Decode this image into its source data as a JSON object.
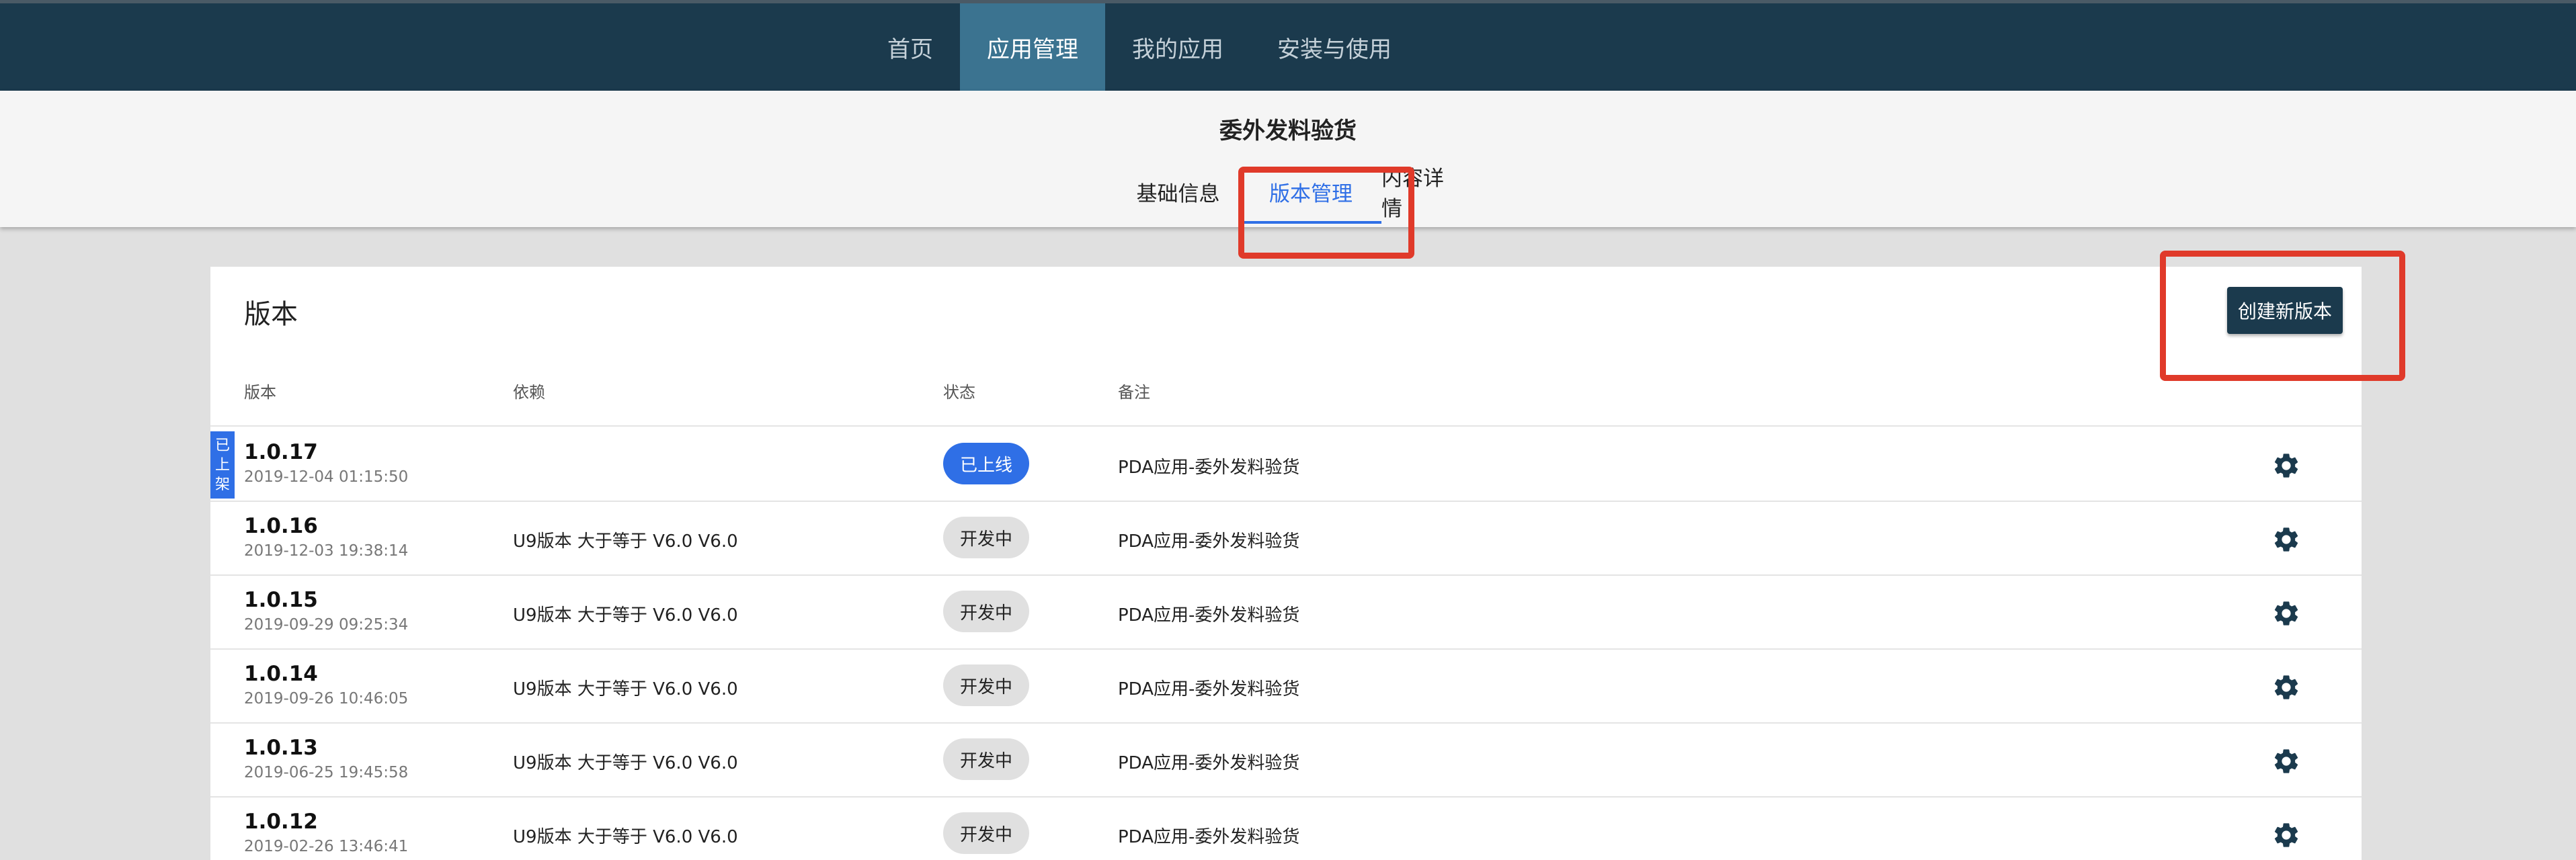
{
  "nav": {
    "items": [
      {
        "label": "首页",
        "active": false
      },
      {
        "label": "应用管理",
        "active": true
      },
      {
        "label": "我的应用",
        "active": false
      },
      {
        "label": "安装与使用",
        "active": false
      }
    ]
  },
  "app": {
    "title": "委外发料验货"
  },
  "tabs": [
    {
      "label": "基础信息",
      "active": false
    },
    {
      "label": "版本管理",
      "active": true
    },
    {
      "label": "内容详情",
      "active": false
    }
  ],
  "versions": {
    "title": "版本",
    "create_button": "创建新版本",
    "columns": [
      "版本",
      "依赖",
      "状态",
      "备注"
    ],
    "ribbon": [
      "已",
      "上",
      "架"
    ],
    "rows": [
      {
        "version": "1.0.17",
        "time": "2019-12-04 01:15:50",
        "dependency": "",
        "status": "已上线",
        "note": "PDA应用-委外发料验货"
      },
      {
        "version": "1.0.16",
        "time": "2019-12-03 19:38:14",
        "dependency": "U9版本 大于等于 V6.0 V6.0",
        "status": "开发中",
        "note": "PDA应用-委外发料验货"
      },
      {
        "version": "1.0.15",
        "time": "2019-09-29 09:25:34",
        "dependency": "U9版本 大于等于 V6.0 V6.0",
        "status": "开发中",
        "note": "PDA应用-委外发料验货"
      },
      {
        "version": "1.0.14",
        "time": "2019-09-26 10:46:05",
        "dependency": "U9版本 大于等于 V6.0 V6.0",
        "status": "开发中",
        "note": "PDA应用-委外发料验货"
      },
      {
        "version": "1.0.13",
        "time": "2019-06-25 19:45:58",
        "dependency": "U9版本 大于等于 V6.0 V6.0",
        "status": "开发中",
        "note": "PDA应用-委外发料验货"
      },
      {
        "version": "1.0.12",
        "time": "2019-02-26 13:46:41",
        "dependency": "U9版本 大于等于 V6.0 V6.0",
        "status": "开发中",
        "note": "PDA应用-委外发料验货"
      }
    ]
  },
  "colors": {
    "nav_bg": "#1b3a4d",
    "nav_active": "#3b7390",
    "accent_blue": "#2f6fe6",
    "highlight_red": "#e03a2a"
  },
  "icons": {
    "row_action": "gear-icon"
  }
}
